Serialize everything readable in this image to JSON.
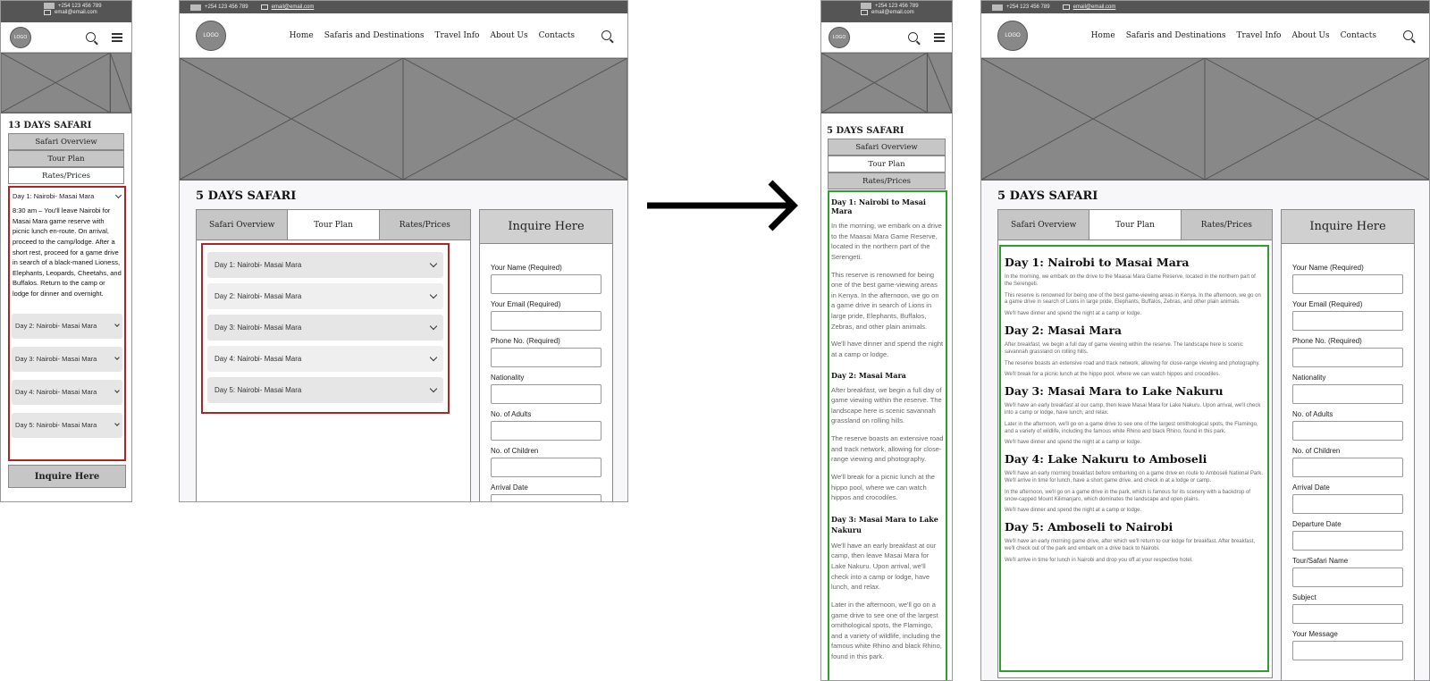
{
  "common": {
    "phone": "+254 123 456 789",
    "email": "email@email.com",
    "logo": "LOGO",
    "nav_links": [
      "Home",
      "Safaris and Destinations",
      "Travel Info",
      "About Us",
      "Contacts"
    ],
    "tabs": [
      "Safari Overview",
      "Tour Plan",
      "Rates/Prices"
    ],
    "inquire": "Inquire Here"
  },
  "mobile_before": {
    "title": "13 DAYS SAFARI",
    "day1_label": "Day 1: Nairobi- Masai Mara",
    "day1_text": "8:30 am – You'll leave Nairobi for Masai Mara game reserve with picnic lunch en-route. On arrival, proceed to the camp/lodge. After a short rest, proceed for a game drive in search of a black-maned Lioness, Elephants, Leopards, Cheetahs, and Buffalos. Return to the camp or lodge for dinner and overnight.",
    "days": [
      "Day 2: Nairobi- Masai Mara",
      "Day 3: Nairobi- Masai Mara",
      "Day 4: Nairobi- Masai Mara",
      "Day 5: Nairobi- Masai Mara"
    ],
    "inquire": "Inquire Here"
  },
  "desktop_before": {
    "title": "5 DAYS SAFARI",
    "days": [
      "Day 1: Nairobi- Masai Mara",
      "Day 2: Nairobi- Masai Mara",
      "Day 3: Nairobi- Masai Mara",
      "Day 4: Nairobi- Masai Mara",
      "Day 5: Nairobi- Masai Mara"
    ],
    "form_labels": [
      "Your Name (Required)",
      "Your Email (Required)",
      "Phone  No. (Required)",
      "Nationality",
      "No. of Adults",
      "No. of Children",
      "Arrival Date"
    ]
  },
  "mobile_after": {
    "title": "5 DAYS SAFARI",
    "d1_title": "Day 1: Nairobi to Masai Mara",
    "d1_p1": "In the morning, we embark on a drive to the Maasai Mara Game Reserve, located in the northern part of the Serengeti.",
    "d1_p2": "This reserve is renowned for being one of the best game-viewing areas in Kenya. In the afternoon, we go on a game drive in search of Lions in large pride, Elephants, Buffalos, Zebras, and other plain animals.",
    "d1_p3": "We'll have dinner and spend the night at a camp or lodge.",
    "d2_title": "Day 2: Masai Mara",
    "d2_p1": "After breakfast, we begin a full day of game viewing within the reserve. The landscape here is scenic savannah grassland on rolling hills.",
    "d2_p2": "The reserve boasts an extensive road and track network, allowing for close-range viewing and photography.",
    "d2_p3": "We'll break for a picnic lunch at the hippo pool, where we can watch hippos and crocodiles.",
    "d3_title": "Day 3: Masai Mara to Lake Nakuru",
    "d3_p1": "We'll have an early breakfast at our camp, then leave Masai Mara for Lake Nakuru. Upon arrival, we'll check into a camp or lodge, have lunch, and relax.",
    "d3_p2": "Later in the afternoon, we'll go on a game drive to see one of the largest ornithological spots, the Flamingo, and a variety of wildlife, including the famous white Rhino and black Rhino, found in this park."
  },
  "desktop_after": {
    "title": "5 DAYS SAFARI",
    "days": [
      {
        "title": "Day 1: Nairobi to Masai Mara",
        "paras": [
          "In the morning, we embark on the drive to the Maasai Mara Game Reserve, located in the northern part of the Serengeti.",
          "This reserve is renowned for being one of the best game-viewing areas in Kenya. In the afternoon, we go on a game drive in search of Lions in large pride, Elephants, Buffalos, Zebras, and other plain animals.",
          "We'll have dinner and spend the night at a camp or lodge."
        ]
      },
      {
        "title": "Day 2: Masai Mara",
        "paras": [
          "After breakfast, we begin a full day of game viewing within the reserve. The landscape here is scenic savannah grassland on rolling hills.",
          "The reserve boasts an extensive road and track network, allowing for close-range viewing and photography.",
          "We'll break for a picnic lunch at the hippo pool, where we can watch hippos and crocodiles."
        ]
      },
      {
        "title": "Day 3: Masai Mara to Lake Nakuru",
        "paras": [
          "We'll have an early breakfast at our camp, then leave Masai Mara for Lake Nakuru. Upon arrival, we'll check into a camp or lodge, have lunch, and relax.",
          "Later in the afternoon, we'll go on a game drive to see one of the largest ornithological spots, the Flamingo, and a variety of wildlife, including the famous white Rhino and black Rhino, found in this park.",
          "We'll have dinner and spend the night at a camp or lodge."
        ]
      },
      {
        "title": "Day 4: Lake Nakuru to Amboseli",
        "paras": [
          "We'll have an early morning breakfast before embarking on a game drive en route to Amboseli National Park. We'll arrive in time for lunch, have a short game drive, and check in at a lodge or camp.",
          "In the afternoon, we'll go on a game drive in the park, which is famous for its scenery with a backdrop of snow-capped Mount Kilimanjaro, which dominates the landscape and open plains.",
          "We'll have dinner and spend the night at a camp or lodge."
        ]
      },
      {
        "title": "Day 5: Amboseli to Nairobi",
        "paras": [
          "We'll have an early morning game drive, after which we'll return to our lodge for breakfast. After breakfast, we'll check out of the park and embark on a drive back to Nairobi.",
          "We'll arrive in time for lunch in Nairobi and drop you off at your respective hotel."
        ]
      }
    ],
    "form_labels": [
      "Your Name (Required)",
      "Your Email (Required)",
      "Phone  No. (Required)",
      "Nationality",
      "No. of Adults",
      "No. of Children",
      "Arrival Date",
      "Departure Date",
      "Tour/Safari Name",
      "Subject",
      "Your Message"
    ]
  }
}
